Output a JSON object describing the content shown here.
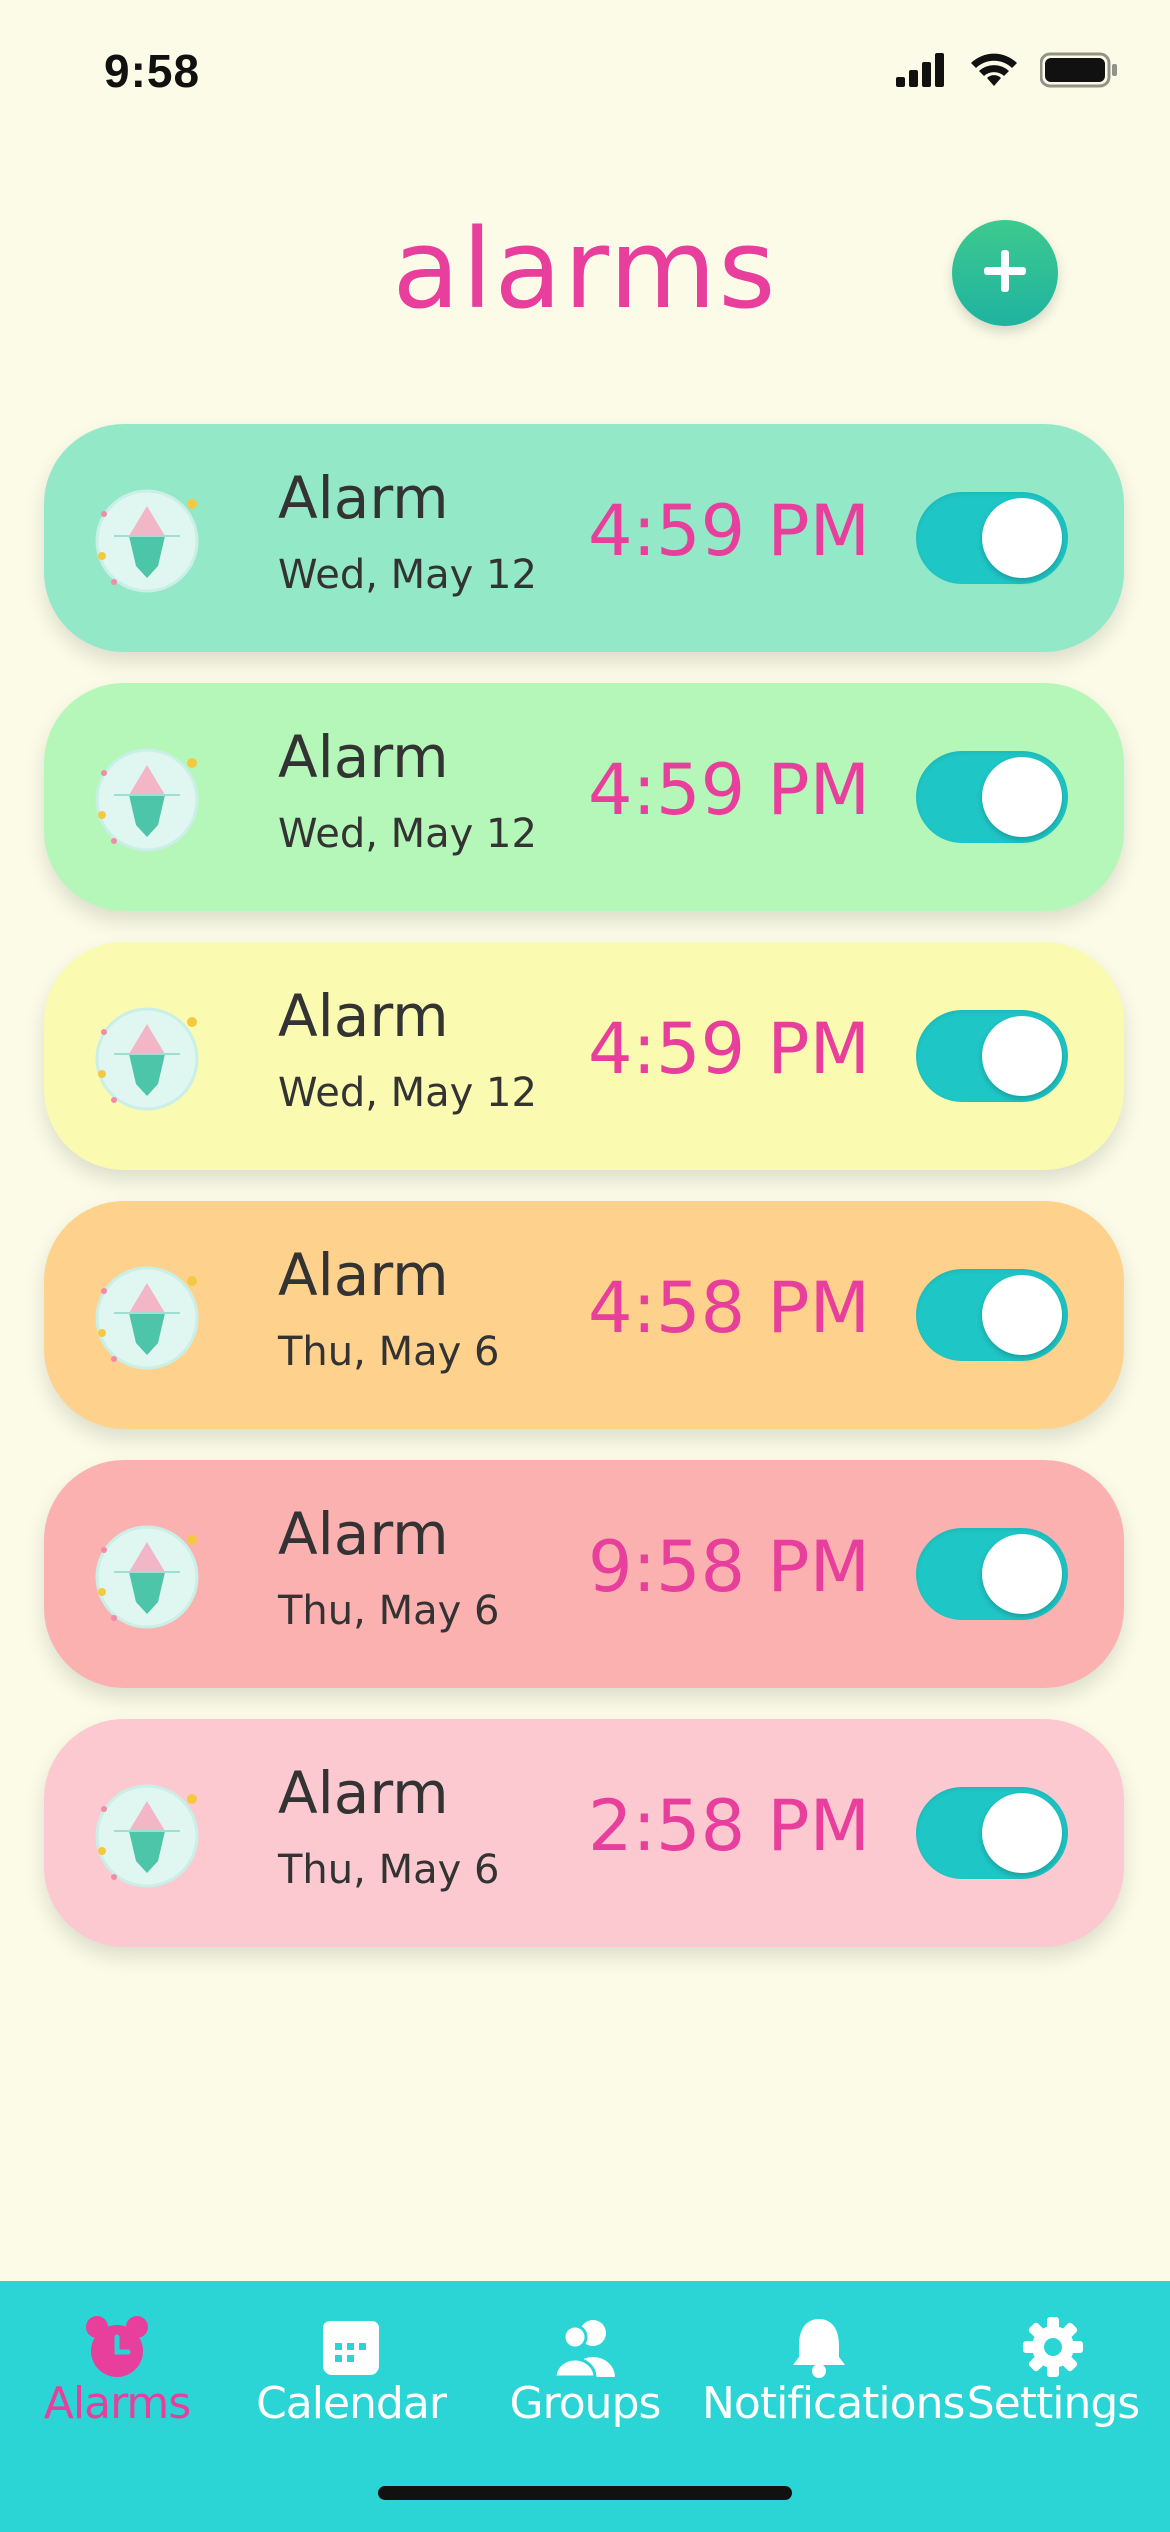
{
  "status_bar": {
    "time": "9:58",
    "icons": [
      "cellular-signal-icon",
      "wifi-icon",
      "battery-icon"
    ]
  },
  "header": {
    "title": "alarms",
    "add_icon": "plus-icon"
  },
  "alarms": [
    {
      "label": "Alarm",
      "date": "Wed, May 12",
      "time": "4:59 PM",
      "enabled": true,
      "bg": "#93e8c8"
    },
    {
      "label": "Alarm",
      "date": "Wed, May 12",
      "time": "4:59 PM",
      "enabled": true,
      "bg": "#b5f7b8"
    },
    {
      "label": "Alarm",
      "date": "Wed, May 12",
      "time": "4:59 PM",
      "enabled": true,
      "bg": "#fafbb0"
    },
    {
      "label": "Alarm",
      "date": "Thu, May 6",
      "time": "4:58 PM",
      "enabled": true,
      "bg": "#fed28c"
    },
    {
      "label": "Alarm",
      "date": "Thu, May 6",
      "time": "9:58 PM",
      "enabled": true,
      "bg": "#fcb1b1"
    },
    {
      "label": "Alarm",
      "date": "Thu, May 6",
      "time": "2:58 PM",
      "enabled": true,
      "bg": "#fcc9d0"
    }
  ],
  "tabs": [
    {
      "label": "Alarms",
      "icon": "alarm-clock-icon",
      "active": true
    },
    {
      "label": "Calendar",
      "icon": "calendar-icon",
      "active": false
    },
    {
      "label": "Groups",
      "icon": "groups-icon",
      "active": false
    },
    {
      "label": "Notifications",
      "icon": "bell-icon",
      "active": false
    },
    {
      "label": "Settings",
      "icon": "gear-icon",
      "active": false
    }
  ],
  "colors": {
    "accent": "#e83e9c",
    "tab_bar": "#2bd5d5",
    "toggle_on": "#1fc6c6",
    "background": "#fbfbe8"
  }
}
